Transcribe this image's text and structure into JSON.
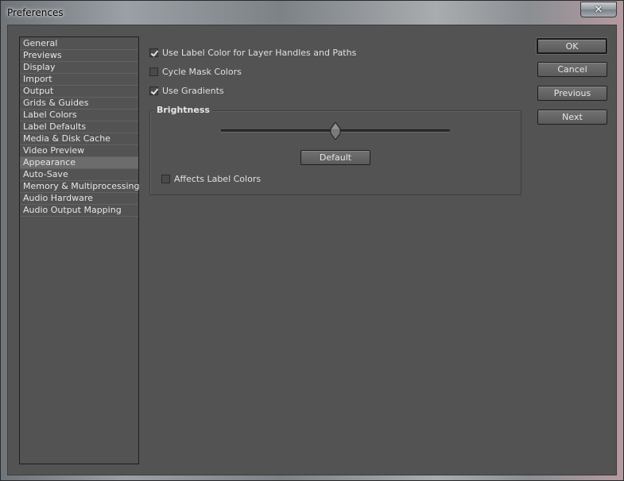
{
  "window": {
    "title": "Preferences",
    "close_glyph": "✕"
  },
  "sidebar": {
    "selected_index": 10,
    "items": [
      {
        "label": "General"
      },
      {
        "label": "Previews"
      },
      {
        "label": "Display"
      },
      {
        "label": "Import"
      },
      {
        "label": "Output"
      },
      {
        "label": "Grids & Guides"
      },
      {
        "label": "Label Colors"
      },
      {
        "label": "Label Defaults"
      },
      {
        "label": "Media & Disk Cache"
      },
      {
        "label": "Video Preview"
      },
      {
        "label": "Appearance"
      },
      {
        "label": "Auto-Save"
      },
      {
        "label": "Memory & Multiprocessing"
      },
      {
        "label": "Audio Hardware"
      },
      {
        "label": "Audio Output Mapping"
      }
    ]
  },
  "options": {
    "use_label_color": {
      "label": "Use Label Color for Layer Handles and Paths",
      "checked": true
    },
    "cycle_mask_colors": {
      "label": "Cycle Mask Colors",
      "checked": false
    },
    "use_gradients": {
      "label": "Use Gradients",
      "checked": true
    }
  },
  "brightness": {
    "title": "Brightness",
    "slider_value": 0.5,
    "default_label": "Default",
    "affects_label_colors": {
      "label": "Affects Label Colors",
      "checked": false
    }
  },
  "buttons": {
    "ok": "OK",
    "cancel": "Cancel",
    "previous": "Previous",
    "next": "Next"
  }
}
